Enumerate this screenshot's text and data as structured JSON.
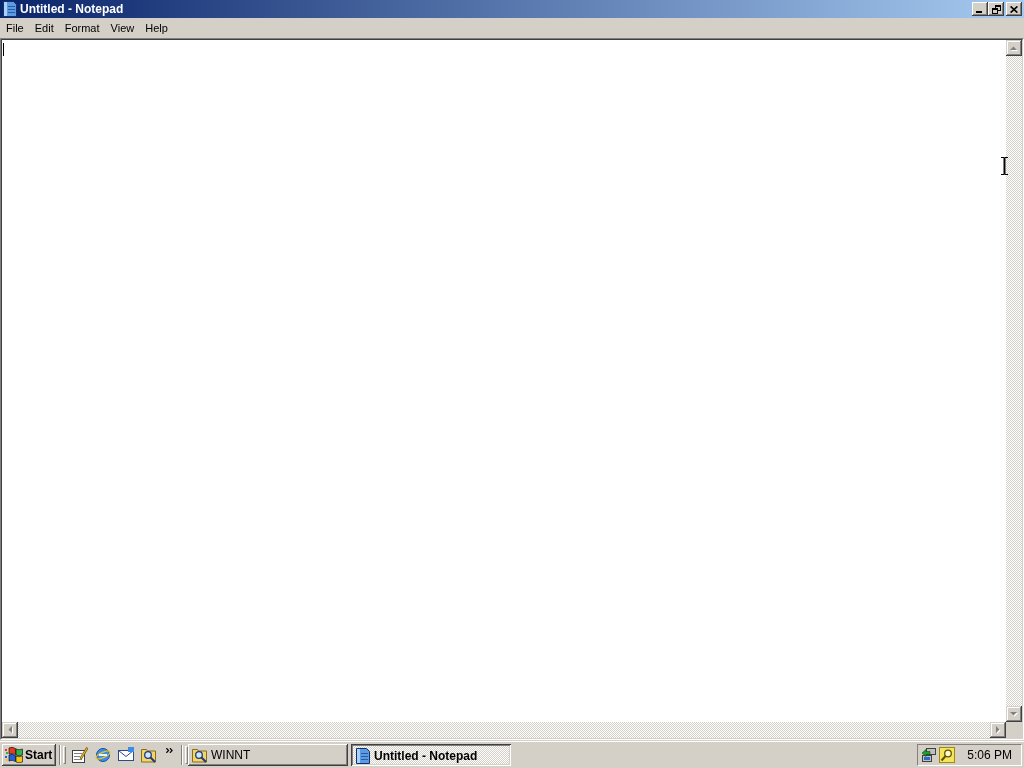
{
  "window": {
    "title": "Untitled - Notepad",
    "active": true,
    "maximized": true
  },
  "menu_bar": [
    {
      "label": "File"
    },
    {
      "label": "Edit"
    },
    {
      "label": "Format"
    },
    {
      "label": "View"
    },
    {
      "label": "Help"
    }
  ],
  "taskbar": {
    "start_button": {
      "label": "Start"
    },
    "tasks": [
      {
        "kind": "explorer",
        "label": "WINNT",
        "selected": false
      },
      {
        "kind": "notepad",
        "label": "Untitled - Notepad",
        "selected": true
      }
    ],
    "clock": "5:06 PM"
  }
}
